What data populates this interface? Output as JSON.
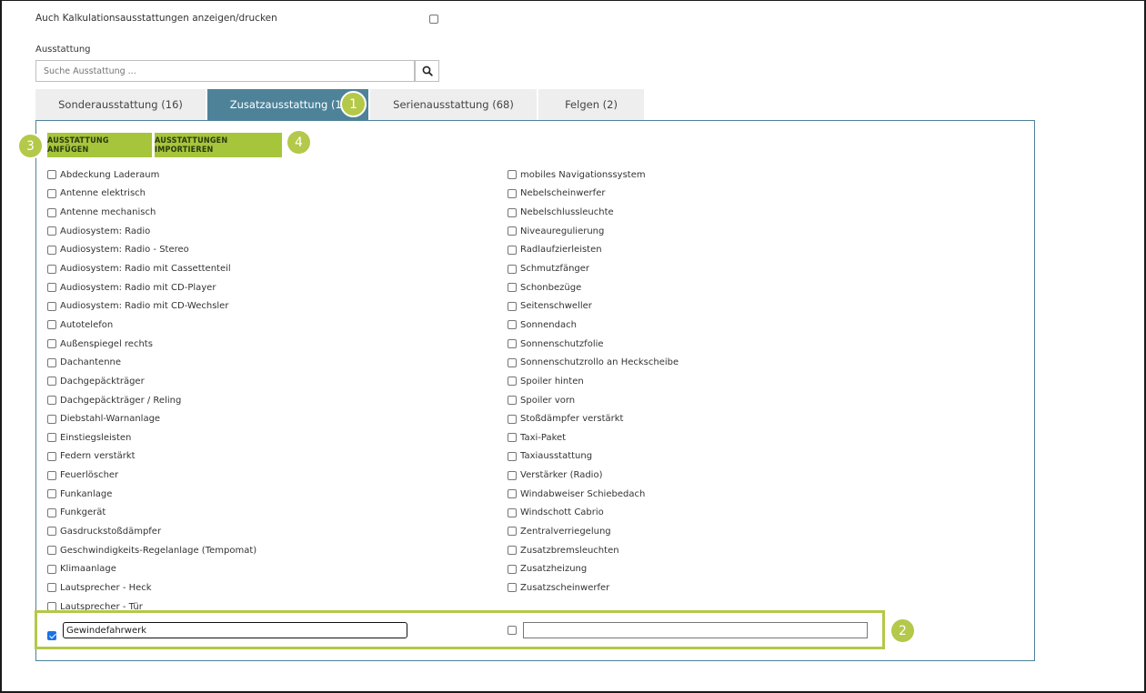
{
  "kalkulation": {
    "label": "Auch Kalkulationsausstattungen anzeigen/drucken",
    "checked": false
  },
  "ausstattung": {
    "label": "Ausstattung",
    "search_placeholder": "Suche Ausstattung ...",
    "search_icon": "search-icon"
  },
  "tabs": [
    {
      "label": "Sonderausstattung (16)",
      "active": false
    },
    {
      "label": "Zusatzausstattung (1)",
      "active": true
    },
    {
      "label": "Serienausstattung (68)",
      "active": false
    },
    {
      "label": "Felgen (2)",
      "active": false
    }
  ],
  "actions": {
    "anfuegen": "AUSSTATTUNG ANFÜGEN",
    "importieren": "AUSSTATTUNGEN IMPORTIEREN"
  },
  "badges": {
    "b1": "1",
    "b2": "2",
    "b3": "3",
    "b4": "4"
  },
  "colors": {
    "tab_active": "#4e8299",
    "accent_green": "#a6c53a",
    "badge": "#b4c84a"
  },
  "left_items": [
    "Abdeckung Laderaum",
    "Antenne elektrisch",
    "Antenne mechanisch",
    "Audiosystem: Radio",
    "Audiosystem: Radio - Stereo",
    "Audiosystem: Radio mit Cassettenteil",
    "Audiosystem: Radio mit CD-Player",
    "Audiosystem: Radio mit CD-Wechsler",
    "Autotelefon",
    "Außenspiegel rechts",
    "Dachantenne",
    "Dachgepäckträger",
    "Dachgepäckträger / Reling",
    "Diebstahl-Warnanlage",
    "Einstiegsleisten",
    "Federn verstärkt",
    "Feuerlöscher",
    "Funkanlage",
    "Funkgerät",
    "Gasdruckstoßdämpfer",
    "Geschwindigkeits-Regelanlage (Tempomat)",
    "Klimaanlage",
    "Lautsprecher - Heck",
    "Lautsprecher - Tür"
  ],
  "right_items": [
    "mobiles Navigationssystem",
    "Nebelscheinwerfer",
    "Nebelschlussleuchte",
    "Niveauregulierung",
    "Radlaufzierleisten",
    "Schmutzfänger",
    "Schonbezüge",
    "Seitenschweller",
    "Sonnendach",
    "Sonnenschutzfolie",
    "Sonnenschutzrollo an Heckscheibe",
    "Spoiler hinten",
    "Spoiler vorn",
    "Stoßdämpfer verstärkt",
    "Taxi-Paket",
    "Taxiausstattung",
    "Verstärker (Radio)",
    "Windabweiser Schiebedach",
    "Windschott Cabrio",
    "Zentralverriegelung",
    "Zusatzbremsleuchten",
    "Zusatzheizung",
    "Zusatzscheinwerfer"
  ],
  "custom": {
    "entry1_value": "Gewindefahrwerk",
    "entry1_checked": true,
    "entry2_value": "",
    "entry2_checked": false
  }
}
